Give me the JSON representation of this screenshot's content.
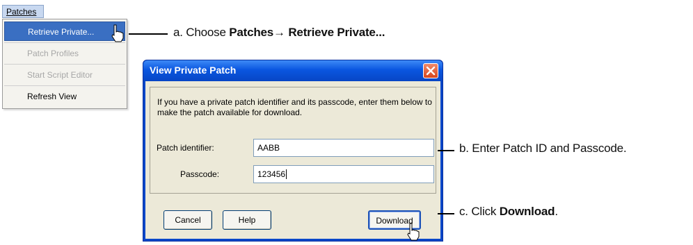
{
  "menubar": {
    "patches_label": "Patches"
  },
  "menu": {
    "items": [
      {
        "label": "Retrieve Private...",
        "state": "highlighted"
      },
      {
        "label": "Patch Profiles",
        "state": "disabled"
      },
      {
        "label": "Start Script Editor",
        "state": "disabled"
      },
      {
        "label": "Refresh View",
        "state": "enabled"
      }
    ]
  },
  "callouts": {
    "a": {
      "prefix": "a. Choose ",
      "bold": "Patches→ Retrieve Private..."
    },
    "b": {
      "text": "b. Enter Patch ID and Passcode."
    },
    "c": {
      "prefix": "c. Click ",
      "bold": "Download",
      "suffix": "."
    }
  },
  "dialog": {
    "title": "View Private Patch",
    "instructions": "If you have a private patch identifier and its passcode, enter them below to make the patch available for download.",
    "patch_identifier_label": "Patch identifier:",
    "patch_identifier_value": "AABB",
    "passcode_label": "Passcode:",
    "passcode_value": "123456",
    "buttons": {
      "cancel": "Cancel",
      "help": "Help",
      "download": "Download"
    }
  },
  "colors": {
    "titlebar": "#0a56e0",
    "menu_highlight": "#3a6fc2",
    "dialog_body": "#ece9d8",
    "close_button": "#d8461c"
  }
}
